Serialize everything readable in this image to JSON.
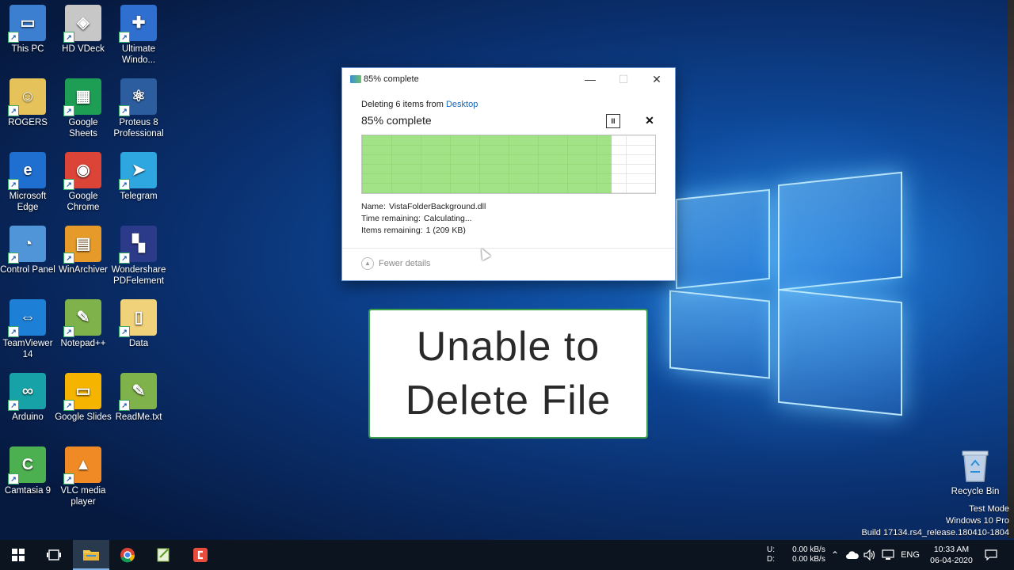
{
  "desktop": {
    "icons": [
      {
        "label": "This PC",
        "icon": "this-pc-icon",
        "color": "#3c7fd1",
        "glyph": "▭"
      },
      {
        "label": "HD VDeck",
        "icon": "hd-vdeck-icon",
        "color": "#c7c7c7",
        "glyph": "◈"
      },
      {
        "label": "Ultimate Windo...",
        "icon": "ultimate-windows-icon",
        "color": "#2f6fd0",
        "glyph": "✚"
      },
      {
        "label": "ROGERS",
        "icon": "folder-user-icon",
        "color": "#e6c35a",
        "glyph": "☺"
      },
      {
        "label": "Google Sheets",
        "icon": "google-sheets-icon",
        "color": "#1e9e55",
        "glyph": "▦"
      },
      {
        "label": "Proteus 8 Professional",
        "icon": "proteus-icon",
        "color": "#2c5d9e",
        "glyph": "⚛"
      },
      {
        "label": "Microsoft Edge",
        "icon": "edge-icon",
        "color": "#1e6fd0",
        "glyph": "e"
      },
      {
        "label": "Google Chrome",
        "icon": "chrome-icon",
        "color": "#db4437",
        "glyph": "◉"
      },
      {
        "label": "Telegram",
        "icon": "telegram-icon",
        "color": "#2ea6e0",
        "glyph": "➤"
      },
      {
        "label": "Control Panel",
        "icon": "control-panel-icon",
        "color": "#4f95d8",
        "glyph": "◔"
      },
      {
        "label": "WinArchiver",
        "icon": "winarchiver-icon",
        "color": "#e59a2a",
        "glyph": "▤"
      },
      {
        "label": "Wondershare PDFelement",
        "icon": "pdfelement-icon",
        "color": "#2c3a8a",
        "glyph": "▚"
      },
      {
        "label": "TeamViewer 14",
        "icon": "teamviewer-icon",
        "color": "#1d7fd6",
        "glyph": "⇔"
      },
      {
        "label": "Notepad++",
        "icon": "notepad-plus-icon",
        "color": "#7fb24a",
        "glyph": "✎"
      },
      {
        "label": "Data",
        "icon": "folder-icon",
        "color": "#f0d27a",
        "glyph": "▯"
      },
      {
        "label": "Arduino",
        "icon": "arduino-icon",
        "color": "#17a2a8",
        "glyph": "∞"
      },
      {
        "label": "Google Slides",
        "icon": "google-slides-icon",
        "color": "#f4b400",
        "glyph": "▭"
      },
      {
        "label": "ReadMe.txt",
        "icon": "text-file-icon",
        "color": "#7fb24a",
        "glyph": "✎"
      },
      {
        "label": "Camtasia 9",
        "icon": "camtasia-icon",
        "color": "#4caf50",
        "glyph": "C"
      },
      {
        "label": "VLC media player",
        "icon": "vlc-icon",
        "color": "#f08a24",
        "glyph": "▲"
      }
    ],
    "recycle_bin": "Recycle Bin",
    "watermark": {
      "line1": "Test Mode",
      "line2": "Windows 10 Pro",
      "line3": "Build 17134.rs4_release.180410-1804"
    }
  },
  "dialog": {
    "title": "85% complete",
    "deleting_prefix": "Deleting 6 items from ",
    "deleting_location": "Desktop",
    "percent_text": "85% complete",
    "progress_fraction": 0.85,
    "details": {
      "name_label": "Name:",
      "name_value": "VistaFolderBackground.dll",
      "time_label": "Time remaining:",
      "time_value": "Calculating...",
      "items_label": "Items remaining:",
      "items_value": "1 (209 KB)"
    },
    "fewer_details": "Fewer details",
    "minimize": "—",
    "maximize": "☐",
    "close": "✕",
    "pause": "II",
    "stop": "✕"
  },
  "caption": {
    "line1": "Unable to",
    "line2": "Delete File"
  },
  "taskbar": {
    "net_up_label": "U:",
    "net_down_label": "D:",
    "net_up_value": "0.00 kB/s",
    "net_down_value": "0.00 kB/s",
    "language": "ENG",
    "time": "10:33 AM",
    "date": "06-04-2020"
  }
}
